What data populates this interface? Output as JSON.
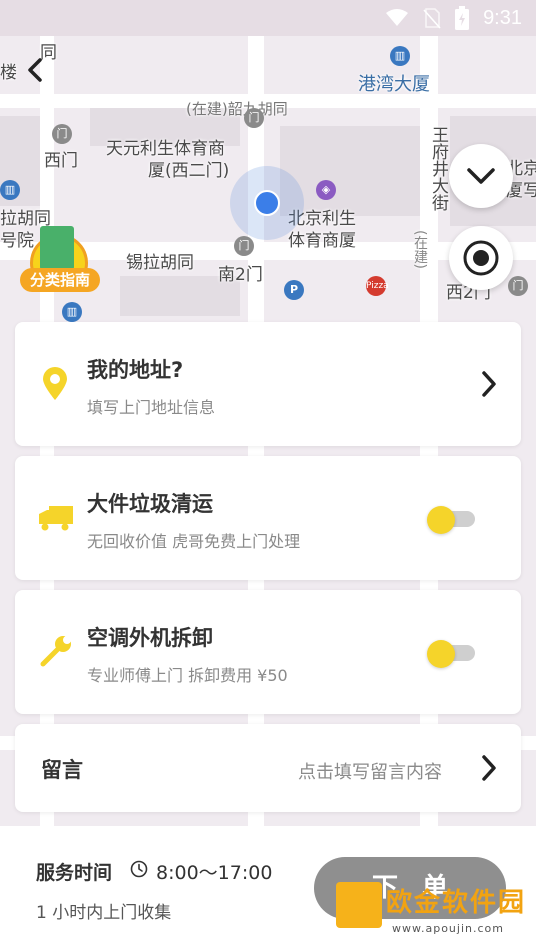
{
  "status_bar": {
    "time": "9:31"
  },
  "map": {
    "labels": {
      "gangwan": "港湾大厦",
      "shaojiu": "(在建)韶九胡同",
      "tianyuan_line1": "天元利生体育商",
      "tianyuan_line2": "厦(西二门)",
      "beijing_line1": "北京利生",
      "beijing_line2": "体育商厦",
      "xilahutong": "锡拉胡同",
      "nan2men": "南2门",
      "ximen": "西门",
      "lahutong_line1": "拉胡同",
      "lahutong_line2": "号院",
      "wangfujing": "王府井大街",
      "xi2men": "西2门",
      "lou": "楼",
      "tong": "同",
      "zaijian": "(在建)",
      "beijing_right_line1": "北京",
      "beijing_right_line2": "厦写"
    },
    "guide_label": "分类指南"
  },
  "address_card": {
    "title": "我的地址?",
    "subtitle": "填写上门地址信息"
  },
  "services": [
    {
      "title": "大件垃圾清运",
      "subtitle": "无回收价值 虎哥免费上门处理",
      "toggle": "off"
    },
    {
      "title": "空调外机拆卸",
      "subtitle": "专业师傅上门  拆卸费用 ¥50",
      "toggle": "off"
    }
  ],
  "message_card": {
    "title": "留言",
    "placeholder": "点击填写留言内容"
  },
  "bottom_bar": {
    "service_label": "服务时间",
    "service_time": "8:00～17:00",
    "service_sub": "1 小时内上门收集",
    "order_button": "下单"
  },
  "watermark": {
    "text": "欧金软件园",
    "url": "www.apoujin.com"
  },
  "colors": {
    "accent_yellow": "#f5d42a",
    "location_blue": "#3b7ee8",
    "order_button_gray": "#8f8f8f"
  }
}
